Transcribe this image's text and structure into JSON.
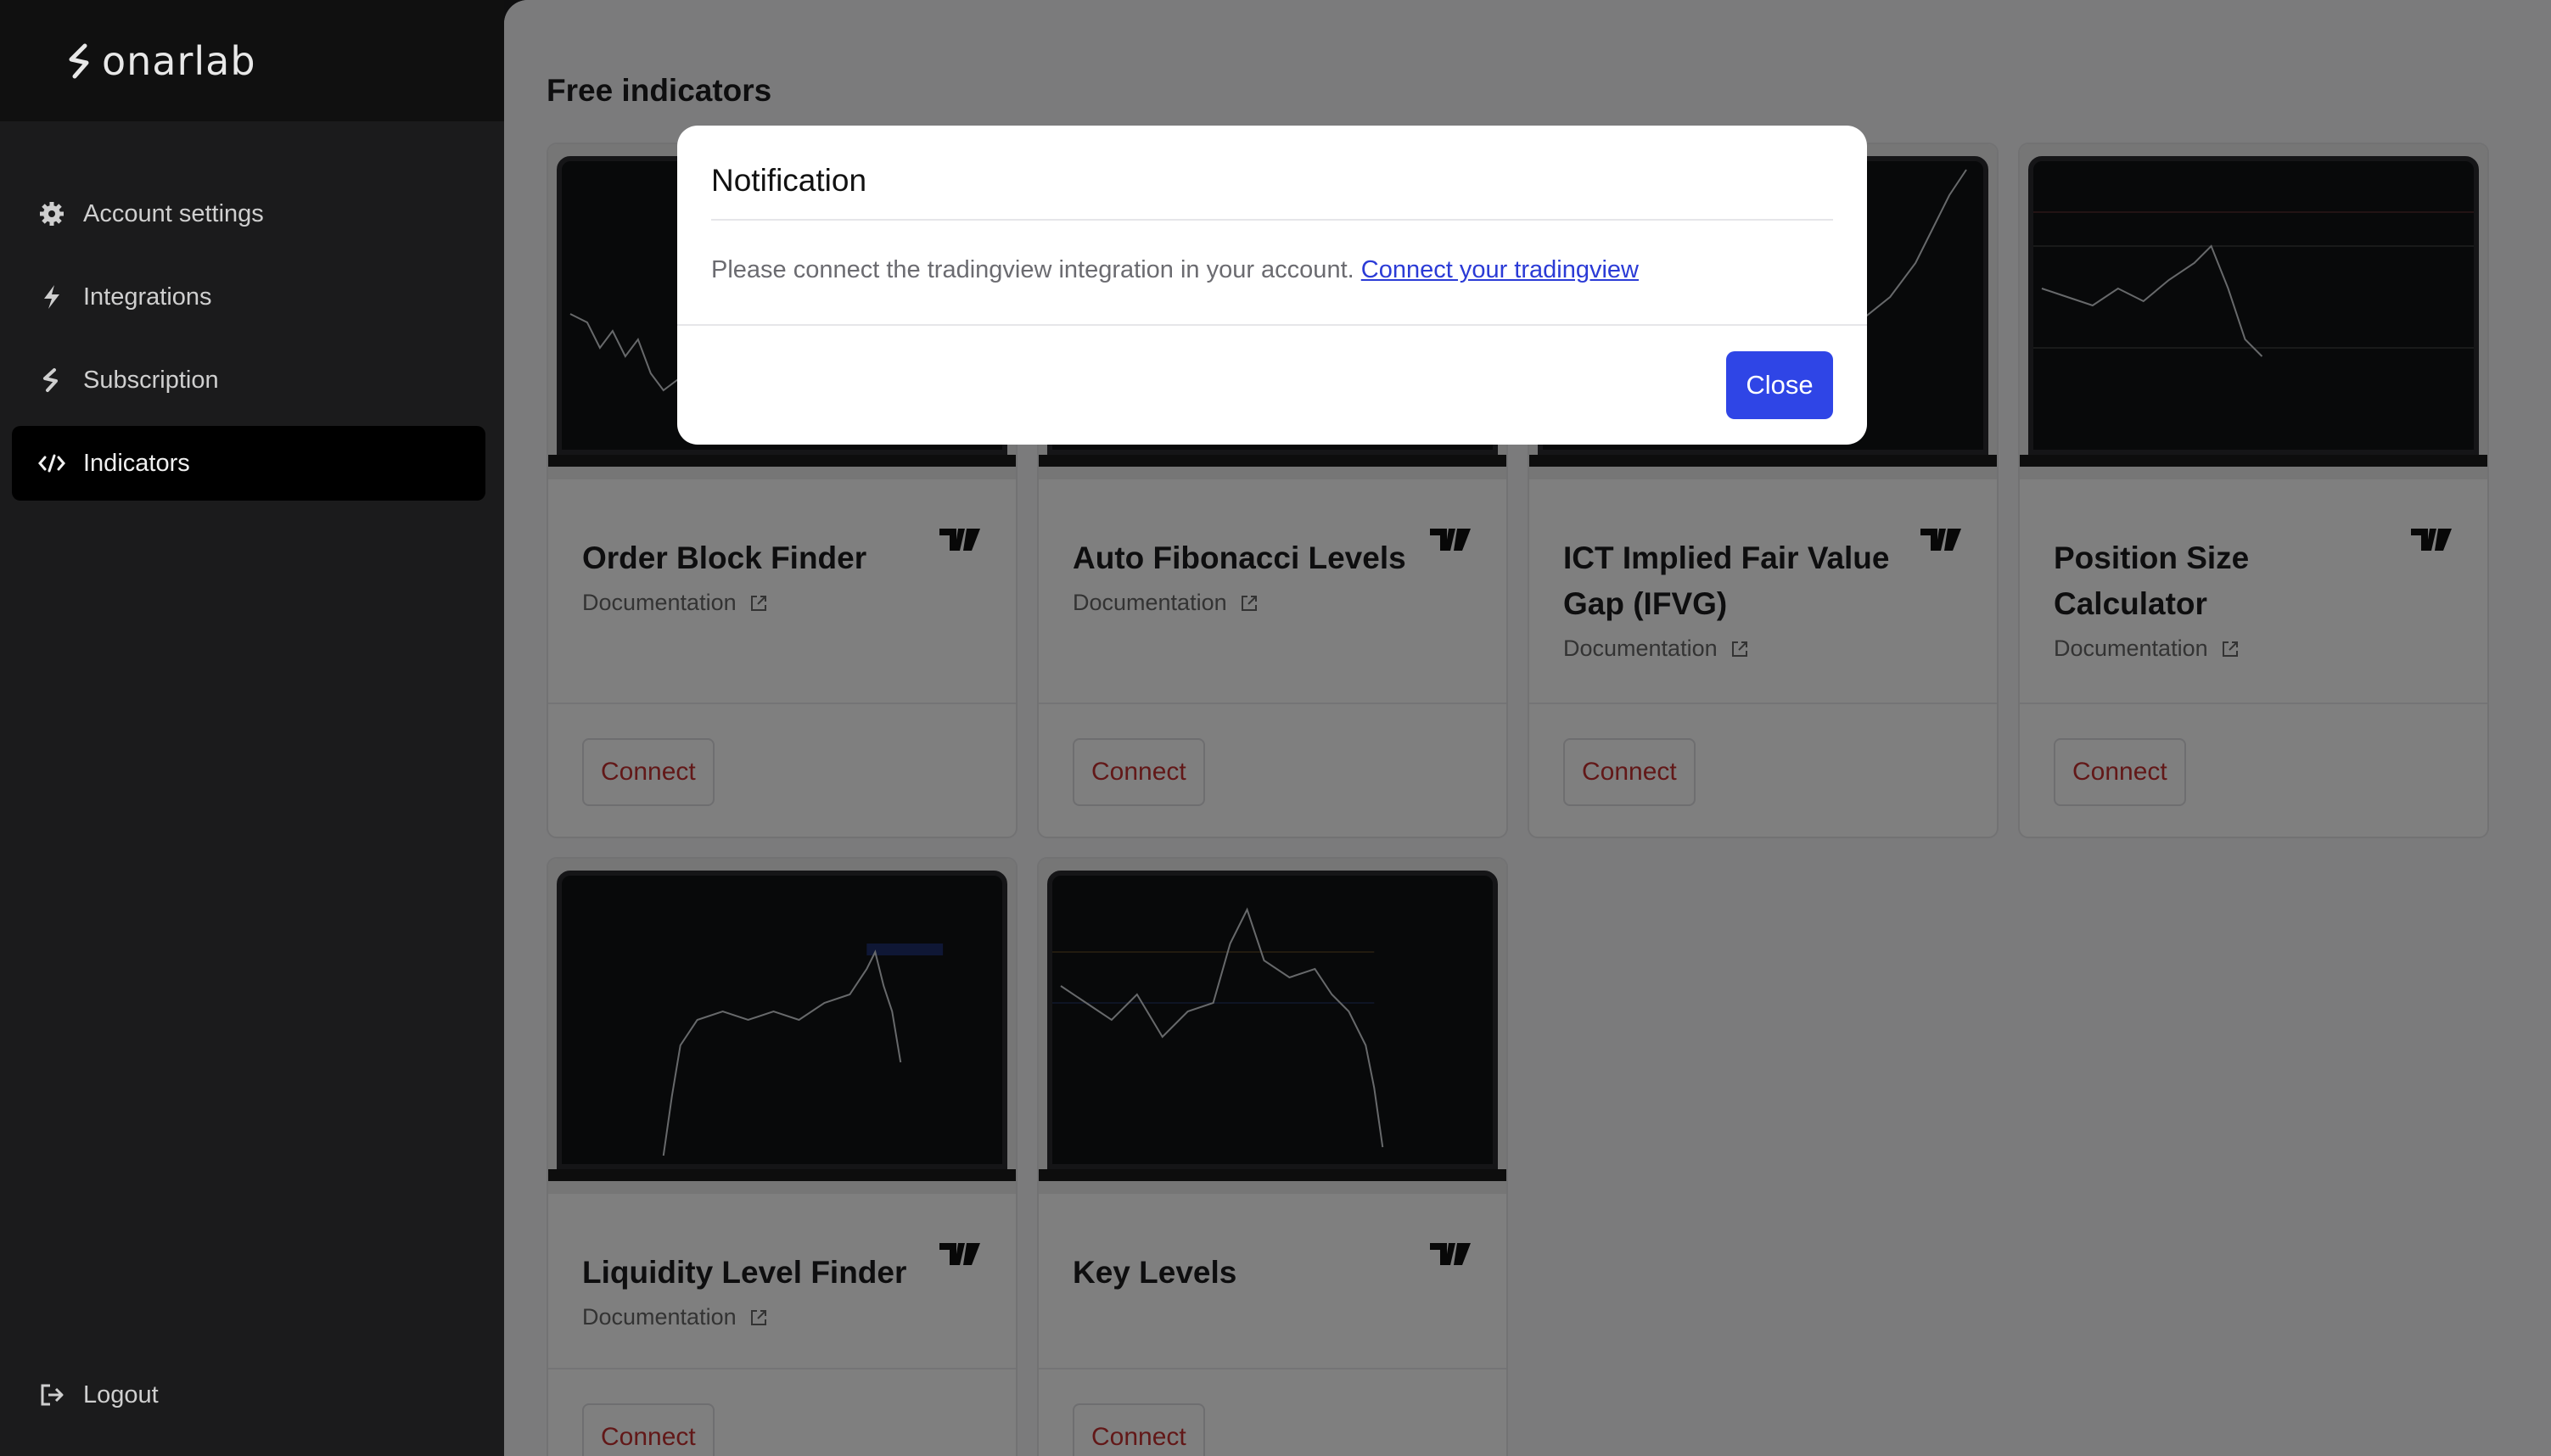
{
  "brand": {
    "name": "onarlab"
  },
  "sidebar": {
    "items": [
      {
        "label": "Account settings",
        "icon": "gear-icon"
      },
      {
        "label": "Integrations",
        "icon": "bolt-icon"
      },
      {
        "label": "Subscription",
        "icon": "brand-s-icon"
      },
      {
        "label": "Indicators",
        "icon": "code-icon",
        "active": true
      }
    ],
    "logout": {
      "label": "Logout",
      "icon": "logout-icon"
    }
  },
  "main": {
    "title": "Free indicators",
    "cards": [
      {
        "title": "Order Block Finder",
        "documentation": "Documentation",
        "connect": "Connect"
      },
      {
        "title": "Auto Fibonacci Levels",
        "documentation": "Documentation",
        "connect": "Connect"
      },
      {
        "title": "ICT Implied Fair Value Gap (IFVG)",
        "documentation": "Documentation",
        "connect": "Connect"
      },
      {
        "title": "Position Size Calculator",
        "documentation": "Documentation",
        "connect": "Connect"
      },
      {
        "title": "Liquidity Level Finder",
        "documentation": "Documentation",
        "connect": "Connect"
      },
      {
        "title": "Key Levels",
        "documentation": "",
        "connect": "Connect"
      }
    ]
  },
  "modal": {
    "title": "Notification",
    "message": "Please connect the tradingview integration in your account.",
    "link": "Connect your tradingview",
    "close": "Close"
  },
  "colors": {
    "sidebar_bg": "#1b1b1c",
    "connect_text": "#c53030",
    "primary_button": "#2f45e6",
    "link": "#2b3bd6"
  }
}
